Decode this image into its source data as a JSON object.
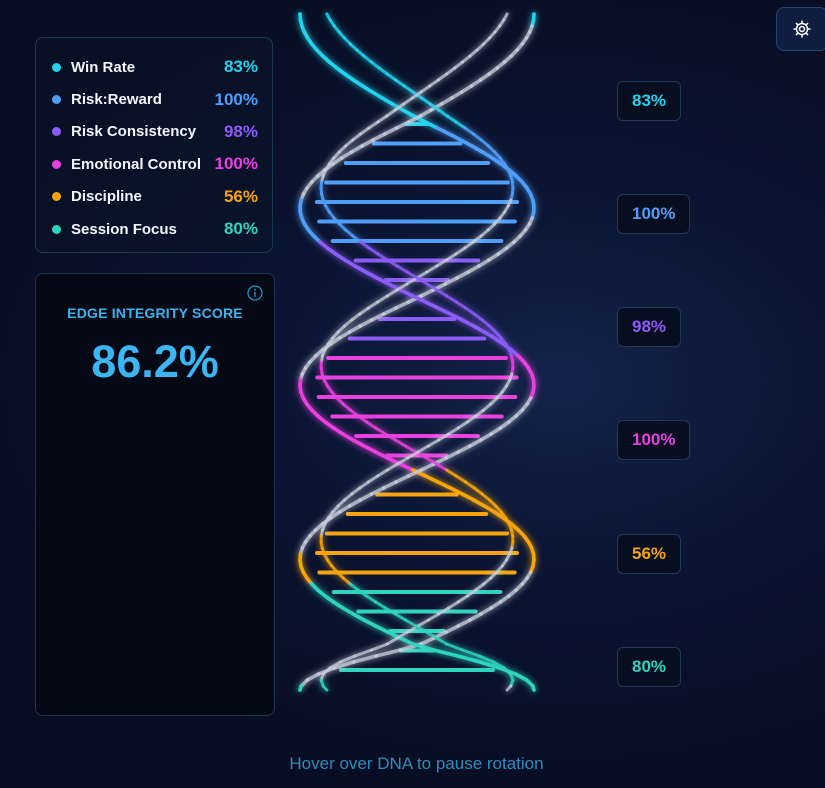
{
  "metrics": [
    {
      "label": "Win Rate",
      "value": "83%",
      "color": "#22d3ee"
    },
    {
      "label": "Risk:Reward",
      "value": "100%",
      "color": "#4f9ef8"
    },
    {
      "label": "Risk Consistency",
      "value": "98%",
      "color": "#8b5cf6"
    },
    {
      "label": "Emotional Control",
      "value": "100%",
      "color": "#e940e0"
    },
    {
      "label": "Discipline",
      "value": "56%",
      "color": "#f5a50b"
    },
    {
      "label": "Session Focus",
      "value": "80%",
      "color": "#2dd4bf"
    }
  ],
  "score": {
    "title": "EDGE INTEGRITY SCORE",
    "value": "86.2%",
    "color": "#3bb6f3"
  },
  "icons": {
    "info": "info-icon",
    "settings": "gear-icon"
  },
  "hint": "Hover over DNA to pause rotation",
  "colors": {
    "strand_neutral": "#c9cfdd"
  }
}
